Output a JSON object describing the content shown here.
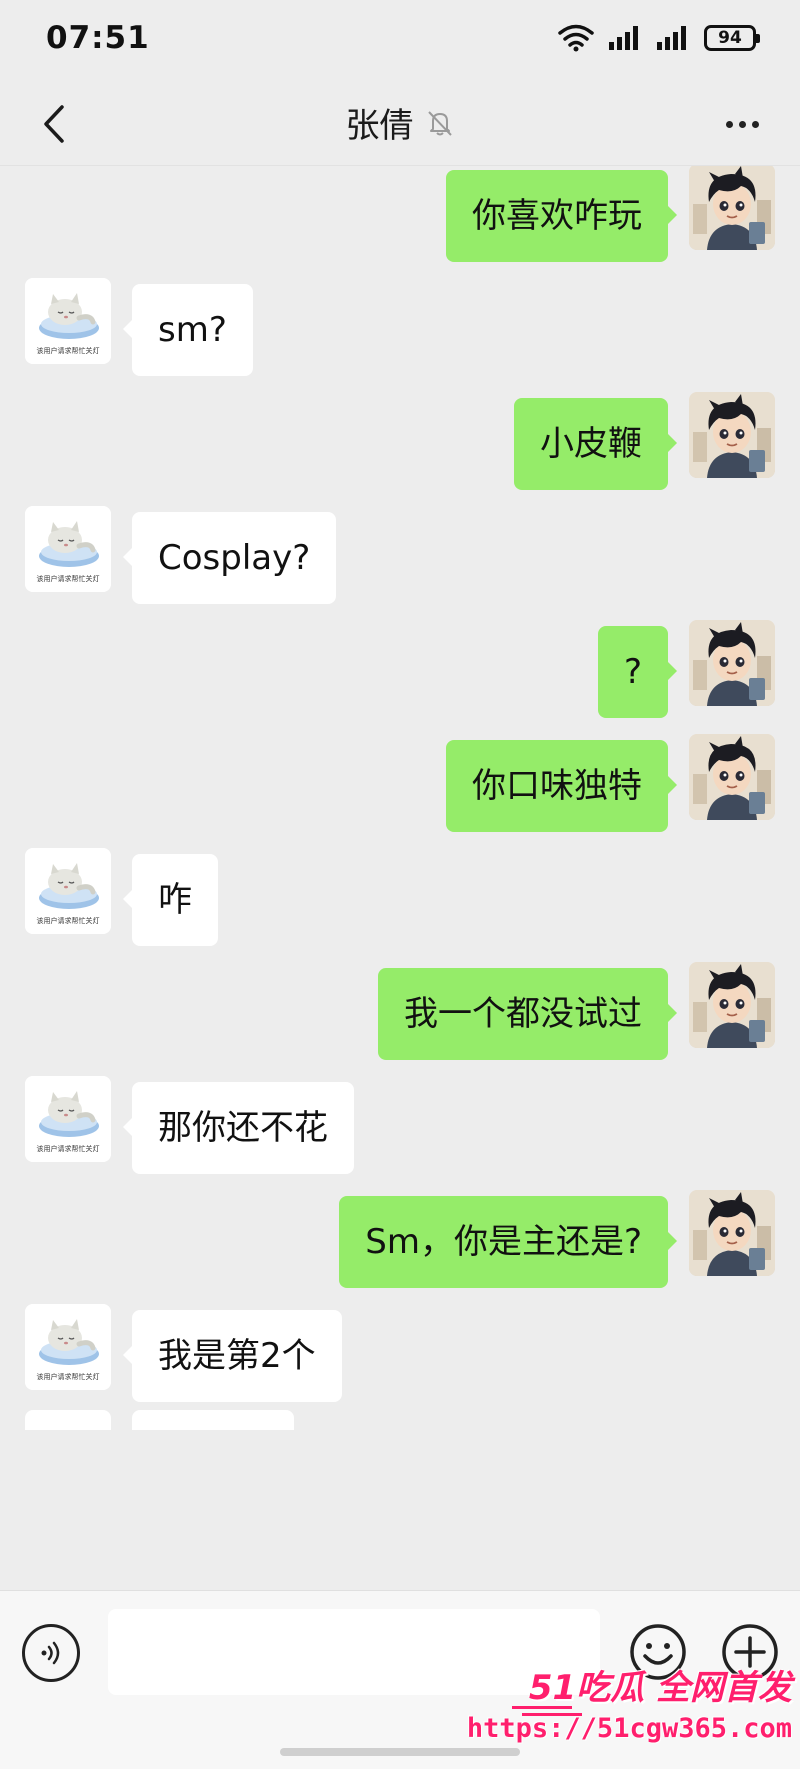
{
  "status_bar": {
    "time": "07:51",
    "battery": "94"
  },
  "header": {
    "title": "张倩"
  },
  "messages": [
    {
      "side": "right",
      "text": "你喜欢咋玩"
    },
    {
      "side": "left",
      "text": "sm?"
    },
    {
      "side": "right",
      "text": "小皮鞭"
    },
    {
      "side": "left",
      "text": "Cosplay?"
    },
    {
      "side": "right",
      "text": "?"
    },
    {
      "side": "right",
      "text": "你口味独特"
    },
    {
      "side": "left",
      "text": "咋"
    },
    {
      "side": "right",
      "text": "我一个都没试过"
    },
    {
      "side": "left",
      "text": "那你还不花"
    },
    {
      "side": "right",
      "text": "Sm，你是主还是?"
    },
    {
      "side": "left",
      "text": "我是第2个"
    }
  ],
  "avatar_caption": "该用户请求帮忙关灯",
  "input": {
    "value": ""
  },
  "watermark": {
    "brand": "51吃瓜 全网首发",
    "url": "https://51cgw365.com"
  },
  "colors": {
    "self_bubble": "#95ec69",
    "other_bubble": "#ffffff",
    "background": "#ededed",
    "watermark": "#ff1f6d"
  }
}
